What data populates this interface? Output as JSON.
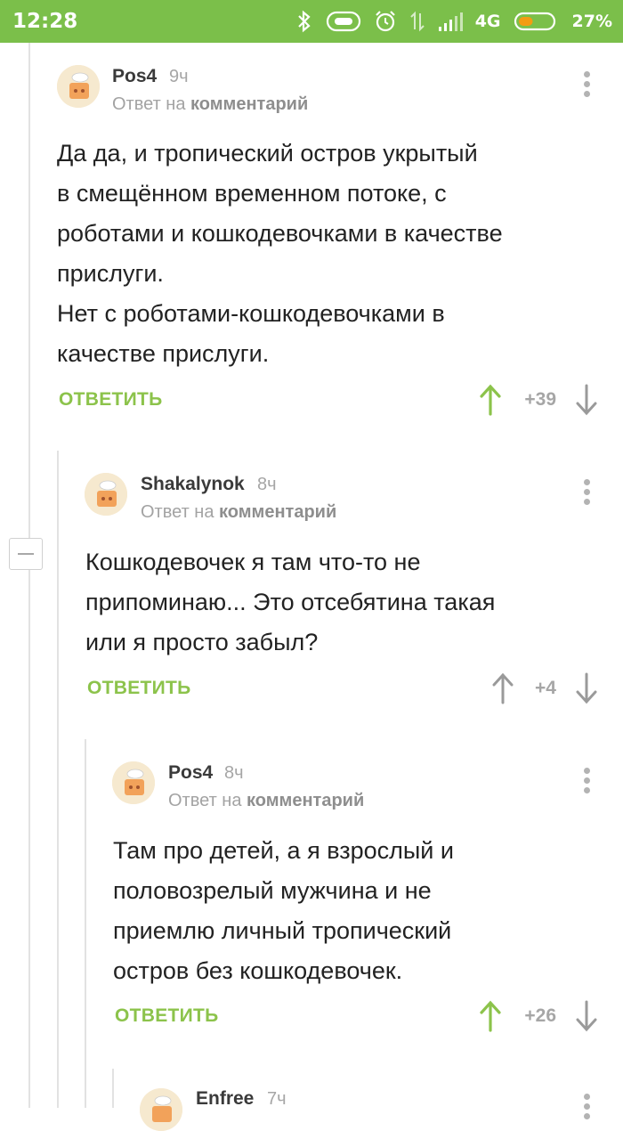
{
  "status_bar": {
    "time": "12:28",
    "network": "4G",
    "battery": "27%",
    "battery_level": 0.27,
    "colors": {
      "bg": "#7bbf4a",
      "battery_low": "#f39c12"
    }
  },
  "colors": {
    "accent_green": "#8cc34b",
    "muted": "#a6a6a6"
  },
  "comments": [
    {
      "author": "Pos4",
      "time": "9ч",
      "reply_prefix": "Ответ на",
      "reply_target": "комментарий",
      "text": "Да да, и тропический остров укрытый\nв смещённом временном потоке, с\nроботами и кошкодевочками в качестве\nприслуги.\nНет с роботами-кошкодевочками в\nкачестве прислуги.",
      "reply_label": "ОТВЕТИТЬ",
      "rating": "+39",
      "upvoted": true
    },
    {
      "author": "Shakalynok",
      "time": "8ч",
      "reply_prefix": "Ответ на",
      "reply_target": "комментарий",
      "text": "Кошкодевочек я там что-то не\nприпоминаю... Это отсебятина такая\nили я просто забыл?",
      "reply_label": "ОТВЕТИТЬ",
      "rating": "+4",
      "upvoted": false
    },
    {
      "author": "Pos4",
      "time": "8ч",
      "reply_prefix": "Ответ на",
      "reply_target": "комментарий",
      "text": "Там про детей, а я взрослый и\nполовозрелый мужчина и не\nприемлю личный тропический\nостров без кошкодевочек.",
      "reply_label": "ОТВЕТИТЬ",
      "rating": "+26",
      "upvoted": true
    },
    {
      "author": "Enfree",
      "time": "7ч"
    }
  ]
}
